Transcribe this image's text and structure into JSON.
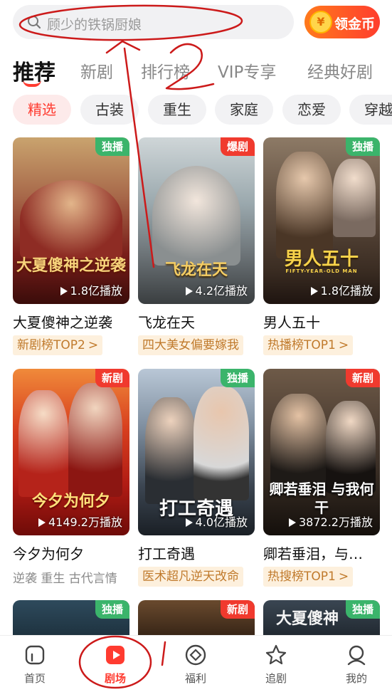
{
  "search": {
    "placeholder": "顾少的铁锅厨娘",
    "icon": "search-icon"
  },
  "coin_button": {
    "symbol": "¥",
    "label": "领金币"
  },
  "tabs": [
    {
      "label": "推荐",
      "active": true
    },
    {
      "label": "新剧"
    },
    {
      "label": "排行榜"
    },
    {
      "label": "VIP专享"
    },
    {
      "label": "经典好剧"
    }
  ],
  "chips": [
    {
      "label": "精选",
      "active": true
    },
    {
      "label": "古装"
    },
    {
      "label": "重生"
    },
    {
      "label": "家庭"
    },
    {
      "label": "恋爱"
    },
    {
      "label": "穿越"
    }
  ],
  "cards": [
    {
      "title": "大夏傻神之逆袭",
      "badge": "独播",
      "badge_color": "green",
      "plays": "1.8亿播放",
      "tag": "新剧榜TOP2",
      "tag_arrow": ">",
      "poster_text": "大夏傻神之逆袭"
    },
    {
      "title": "飞龙在天",
      "badge": "爆剧",
      "badge_color": "red",
      "plays": "4.2亿播放",
      "tag": "四大美女偏要嫁我",
      "poster_text": "飞龙在天"
    },
    {
      "title": "男人五十",
      "badge": "独播",
      "badge_color": "green",
      "plays": "1.8亿播放",
      "tag": "热播榜TOP1",
      "tag_arrow": ">",
      "poster_text": "男人五十",
      "poster_sub": "FIFTY-YEAR-OLD MAN"
    },
    {
      "title": "今夕为何夕",
      "badge": "新剧",
      "badge_color": "red",
      "plays": "4149.2万播放",
      "plain_tag": "逆袭 重生 古代言情",
      "poster_text": "今夕为何夕"
    },
    {
      "title": "打工奇遇",
      "badge": "独播",
      "badge_color": "green",
      "plays": "4.0亿播放",
      "tag": "医术超凡逆天改命",
      "poster_text": "打工奇遇"
    },
    {
      "title": "卿若垂泪，与…",
      "badge": "新剧",
      "badge_color": "red",
      "plays": "3872.2万播放",
      "tag": "热搜榜TOP1",
      "tag_arrow": ">",
      "poster_text": "卿若垂泪 与我何干"
    },
    {
      "badge": "独播",
      "badge_color": "green"
    },
    {
      "badge": "新剧",
      "badge_color": "red"
    },
    {
      "badge": "独播",
      "badge_color": "green",
      "poster_text": "大夏傻神"
    }
  ],
  "bottom_nav": [
    {
      "label": "首页",
      "icon": "home-icon"
    },
    {
      "label": "剧场",
      "icon": "play-icon",
      "active": true
    },
    {
      "label": "福利",
      "icon": "gift-icon"
    },
    {
      "label": "追剧",
      "icon": "star-icon"
    },
    {
      "label": "我的",
      "icon": "profile-icon"
    }
  ],
  "colors": {
    "accent": "#ff3b30",
    "badge_green": "#3bb46b",
    "badge_red": "#f03a2e",
    "tag_bg": "#fdf0dd",
    "tag_text": "#c07a2c",
    "annotation": "#cc1a1a"
  }
}
